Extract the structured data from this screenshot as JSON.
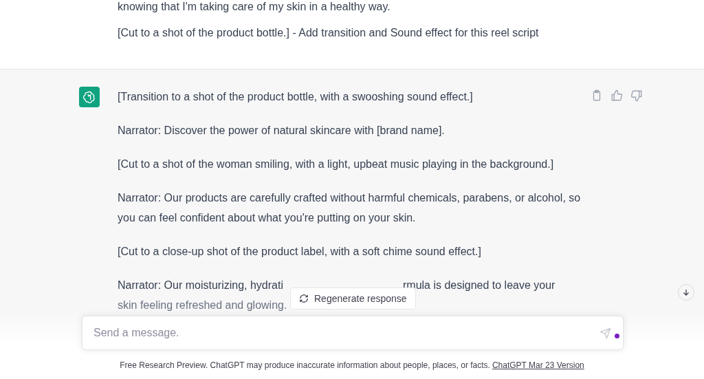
{
  "user_message": {
    "paragraphs": [
      "knowing that I'm taking care of my skin in a healthy way.",
      "[Cut to a shot of the product bottle.] - Add transition and Sound effect for this reel script"
    ]
  },
  "assistant_message": {
    "paragraphs": [
      "[Transition to a shot of the product bottle, with a swooshing sound effect.]",
      "Narrator: Discover the power of natural skincare with [brand name].",
      "[Cut to a shot of the woman smiling, with a light, upbeat music playing in the background.]",
      "Narrator: Our products are carefully crafted without harmful chemicals, parabens, or alcohol, so you can feel confident about what you're putting on your skin.",
      "[Cut to a close-up shot of the product label, with a soft chime sound effect.]"
    ],
    "partly_covered": {
      "line_1_start": "Narrator: Our moisturizing, hydrati",
      "line_1_end": "rmula is designed to leave your",
      "line_2": "skin feeling refreshed and glowing."
    }
  },
  "regenerate_button": "Regenerate response",
  "composer": {
    "placeholder": "Send a message."
  },
  "footer": {
    "text": "Free Research Preview. ChatGPT may produce inaccurate information about people, places, or facts.",
    "link": "ChatGPT Mar 23 Version"
  }
}
